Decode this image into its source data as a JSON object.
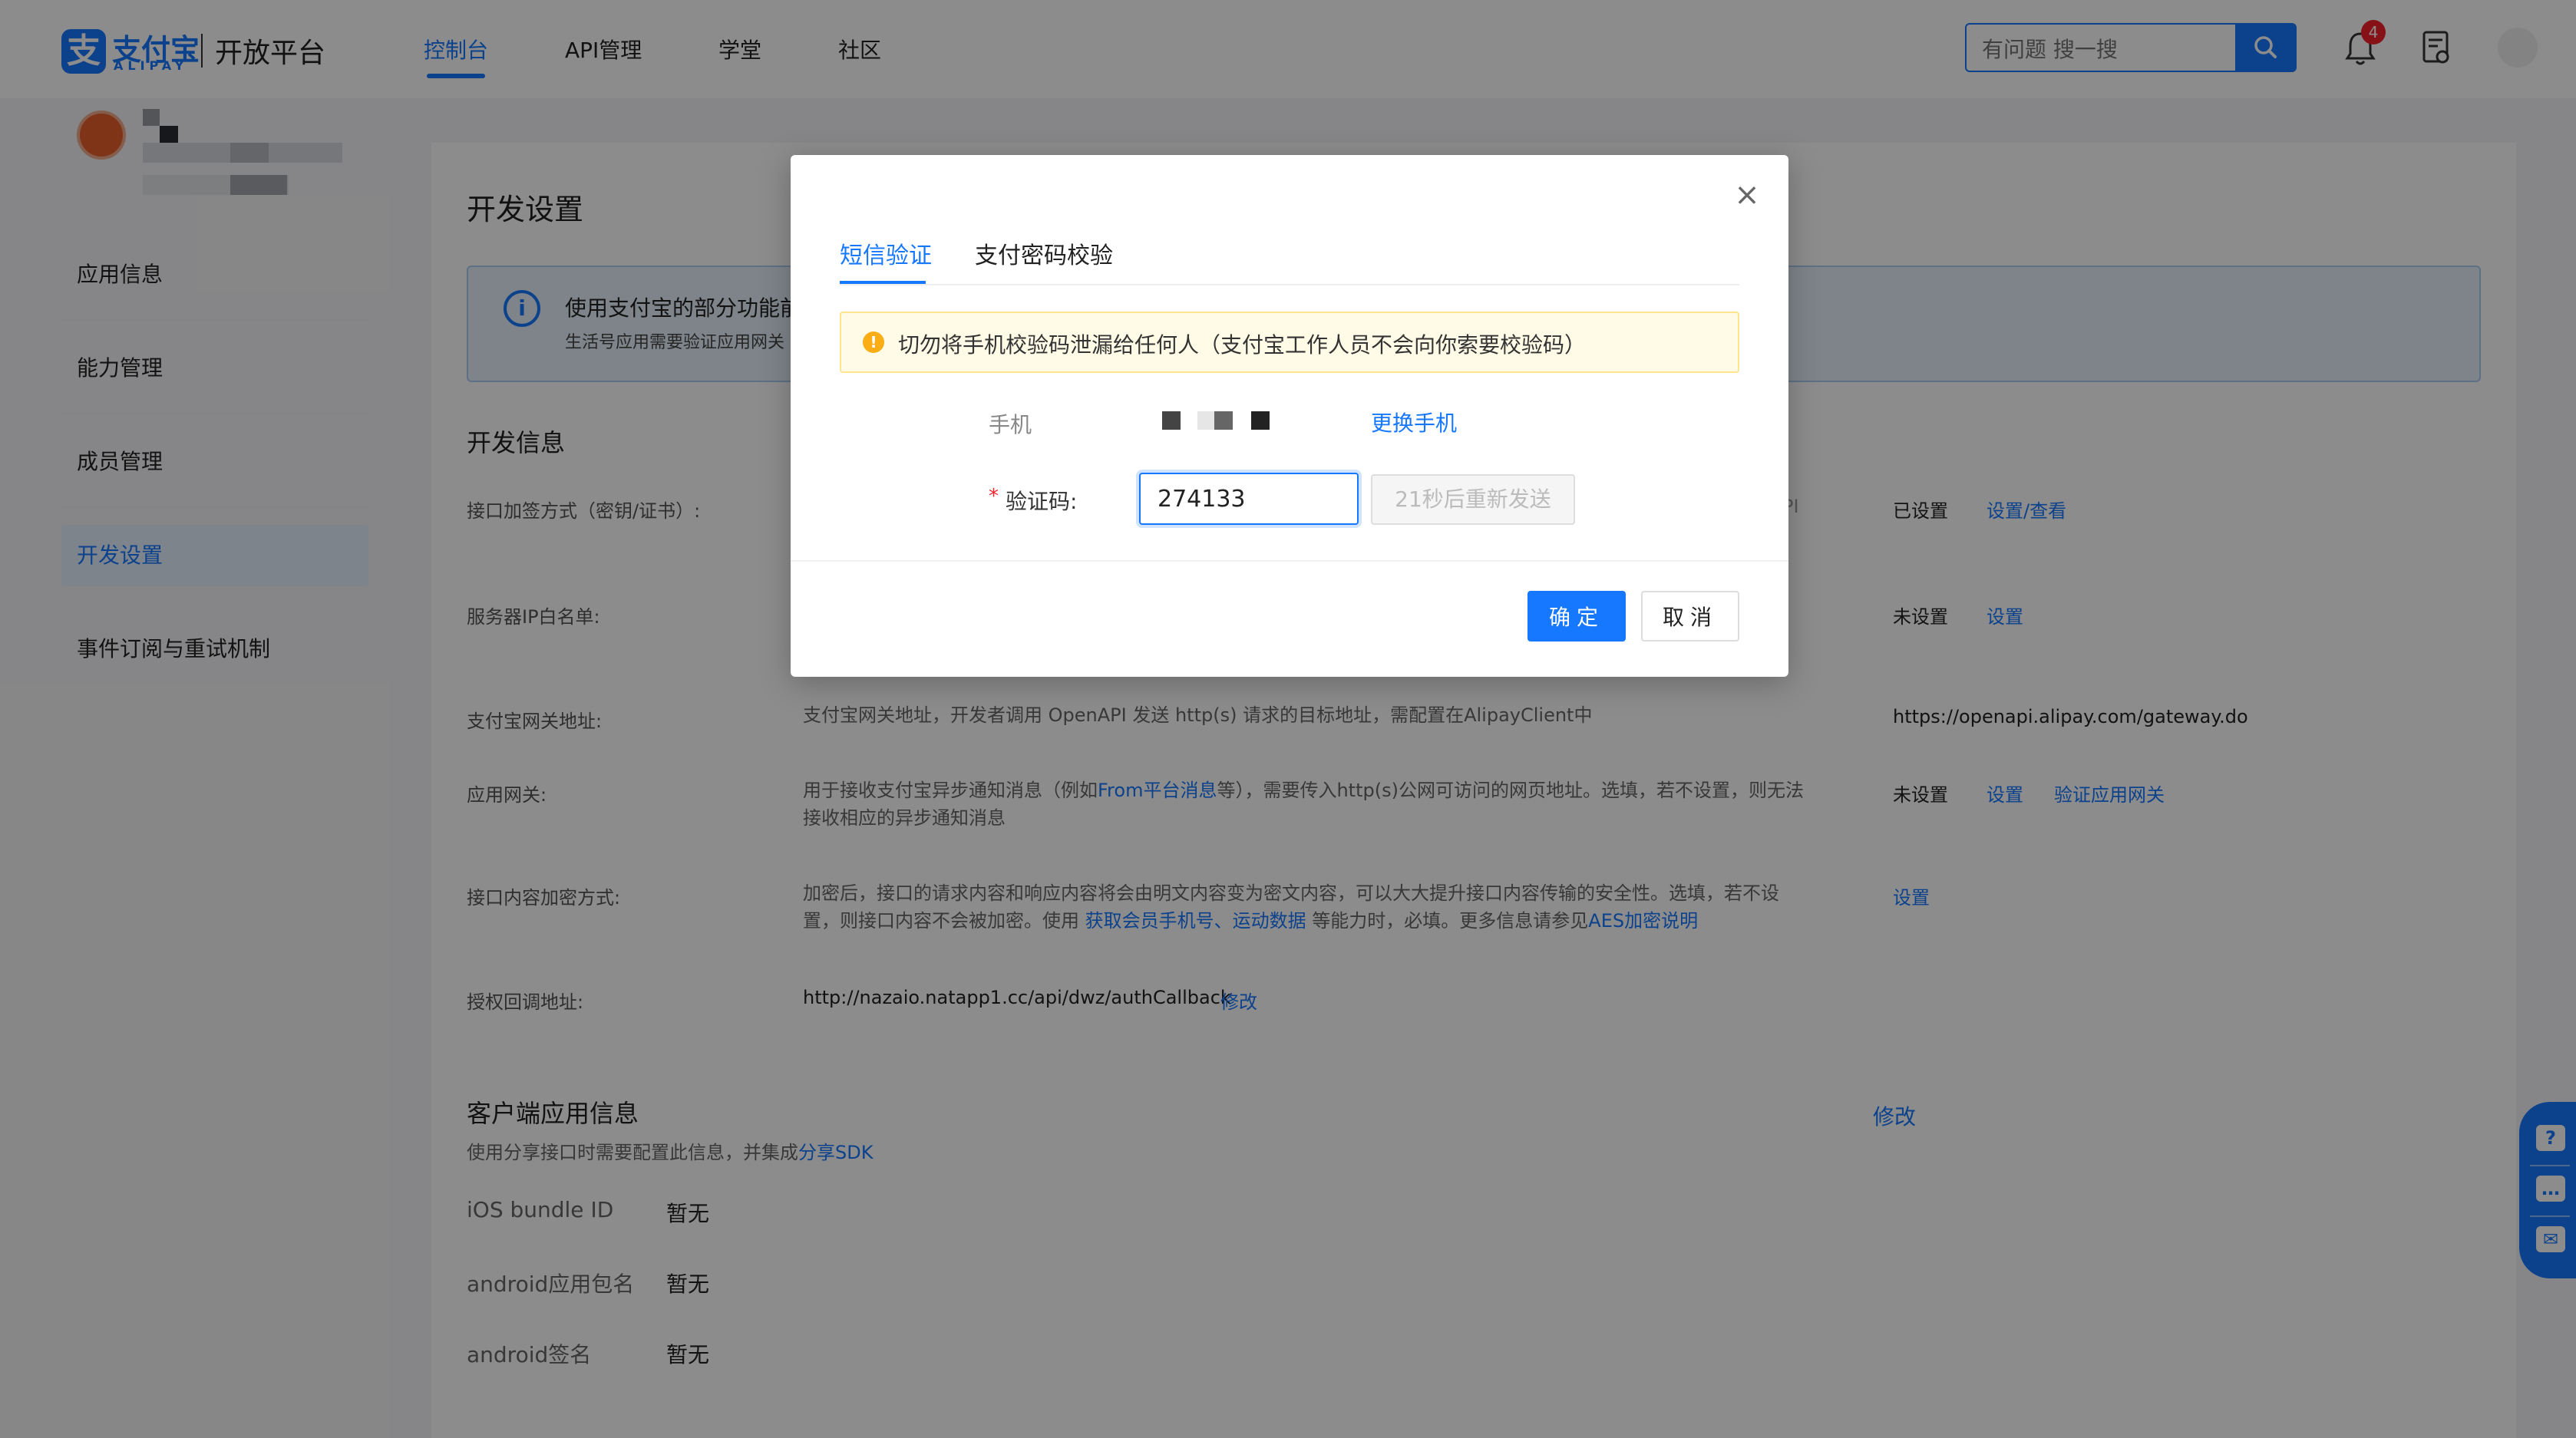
{
  "header": {
    "logo_cn": "支付宝",
    "logo_en": "ALIPAY",
    "platform": "开放平台",
    "nav": [
      "控制台",
      "API管理",
      "学堂",
      "社区"
    ],
    "search_placeholder": "有问题 搜一搜",
    "notification_count": "4"
  },
  "sidebar": {
    "items": [
      "应用信息",
      "能力管理",
      "成员管理",
      "开发设置",
      "事件订阅与重试机制"
    ]
  },
  "main": {
    "title": "开发设置",
    "notice_line1": "使用支付宝的部分功能前",
    "notice_line2": "生活号应用需要验证应用网关",
    "dev_info_title": "开发信息",
    "rows": {
      "sign_label": "接口加签方式（密钥/证书）:",
      "sign_tail": "PI",
      "sign_status": "已设置",
      "sign_action": "设置/查看",
      "ip_label": "服务器IP白名单:",
      "ip_status": "未设置",
      "ip_action": "设置",
      "gateway_label": "支付宝网关地址:",
      "gateway_desc": "支付宝网关地址，开发者调用 OpenAPI 发送 http(s) 请求的目标地址，需配置在AlipayClient中",
      "gateway_value": "https://openapi.alipay.com/gateway.do",
      "app_gateway_label": "应用网关:",
      "app_gateway_desc1_a": "用于接收支付宝异步通知消息（例如",
      "app_gateway_desc1_link": "From平台消息",
      "app_gateway_desc1_b": "等），需要传入http(s)公网可访问的网页地址。选填，若不设置，则无法",
      "app_gateway_desc2": "接收相应的异步通知消息",
      "app_gateway_status": "未设置",
      "app_gateway_action1": "设置",
      "app_gateway_action2": "验证应用网关",
      "enc_label": "接口内容加密方式:",
      "enc_desc1": "加密后，接口的请求内容和响应内容将会由明文内容变为密文内容，可以大大提升接口内容传输的安全性。选填，若不设",
      "enc_desc2_a": "置，则接口内容不会被加密。使用 ",
      "enc_desc2_link1": "获取会员手机号",
      "enc_desc2_sep": "、",
      "enc_desc2_link2": "运动数据",
      "enc_desc2_b": " 等能力时，必填。更多信息请参见",
      "enc_desc2_link3": "AES加密说明",
      "enc_action": "设置",
      "callback_label": "授权回调地址:",
      "callback_value": "http://nazaio.natapp1.cc/api/dwz/authCallback",
      "callback_action": "修改"
    },
    "client_title": "客户端应用信息",
    "client_edit": "修改",
    "client_desc_a": "使用分享接口时需要配置此信息，并集成",
    "client_desc_link": "分享SDK",
    "client_rows": [
      {
        "label": "iOS bundle ID",
        "value": "暂无"
      },
      {
        "label": "android应用包名",
        "value": "暂无"
      },
      {
        "label": "android签名",
        "value": "暂无"
      }
    ]
  },
  "modal": {
    "tabs": [
      "短信验证",
      "支付密码校验"
    ],
    "warning": "切勿将手机校验码泄漏给任何人（支付宝工作人员不会向你索要校验码）",
    "phone_label": "手机",
    "change_phone": "更换手机",
    "code_label": "验证码:",
    "code_value": "274133",
    "resend": "21秒后重新发送",
    "ok": "确定",
    "cancel": "取消"
  },
  "colors": {
    "accent": "#1677ff",
    "warning_bg": "#fffbe6",
    "overlay": "rgba(0,0,0,0.45)"
  }
}
